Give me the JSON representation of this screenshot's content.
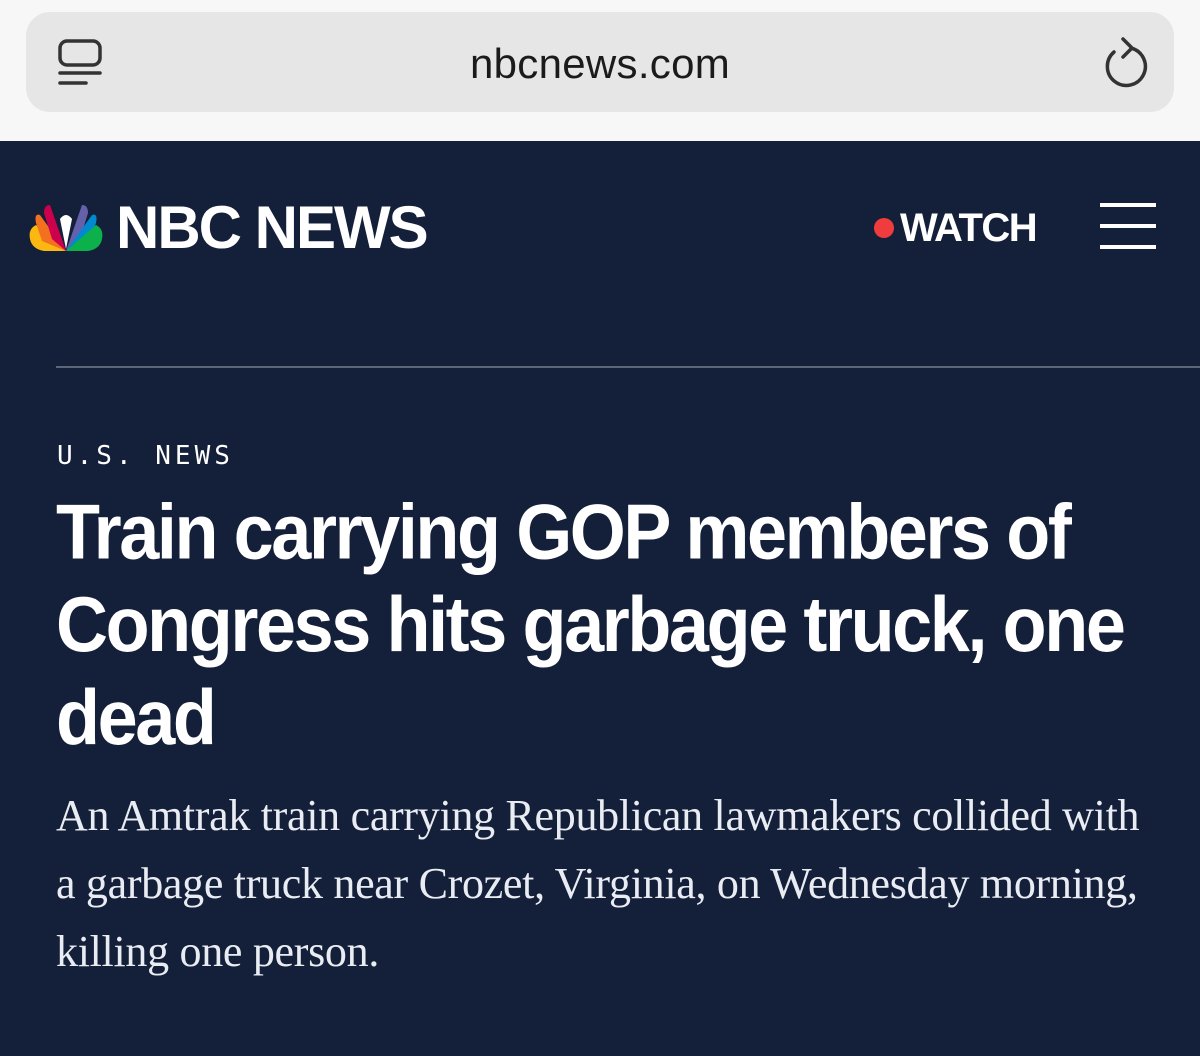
{
  "browser": {
    "url": "nbcnews.com",
    "reader_icon": "reader-mode-icon",
    "reload_icon": "reload-icon"
  },
  "header": {
    "brand": "NBC NEWS",
    "logo_icon": "peacock-logo-icon",
    "watch_label": "WATCH",
    "live_dot_color": "#f03c3c",
    "menu_icon": "hamburger-menu-icon"
  },
  "article": {
    "section": "U.S. NEWS",
    "headline": "Train carrying GOP members of Congress hits garbage truck, one dead",
    "dek": "An Amtrak train carrying Republican lawmakers collided with a garbage truck near Crozet, Virginia, on Wednesday morning, killing one person."
  },
  "colors": {
    "background": "#142039",
    "text": "#ffffff",
    "browser_bar": "#f7f7f7",
    "url_pill": "#e6e6e6"
  }
}
